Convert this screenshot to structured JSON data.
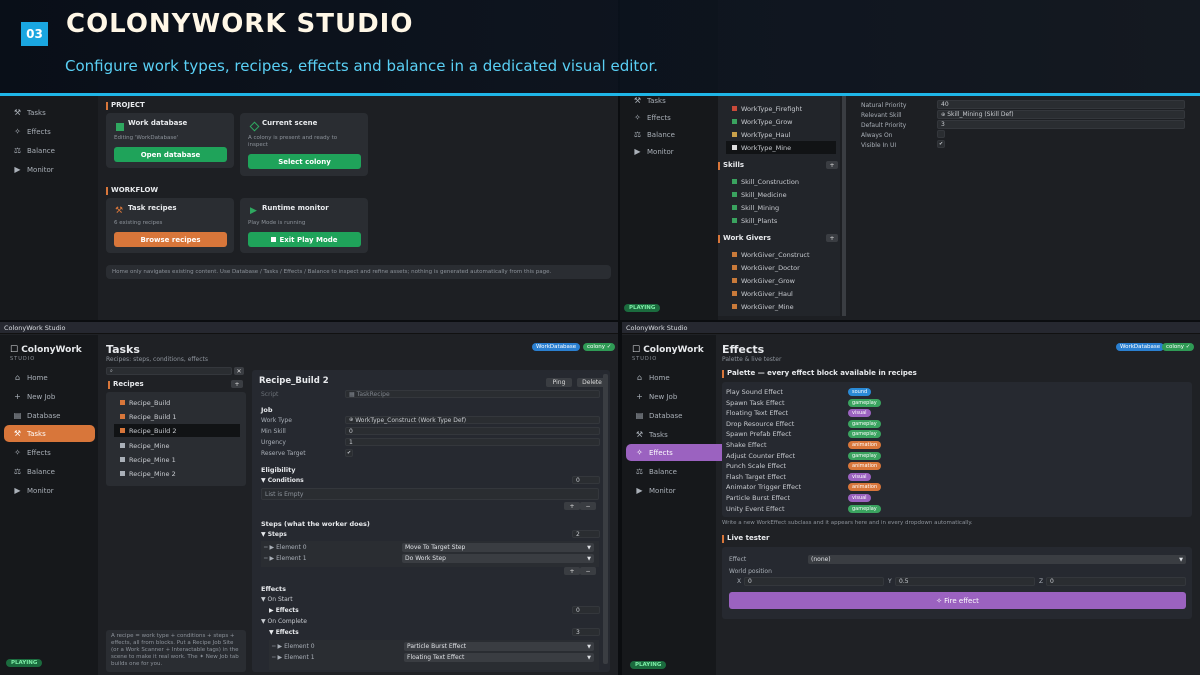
{
  "banner": {
    "badge": "03",
    "title": "COLONYWORK STUDIO",
    "subtitle": "Configure work types, recipes, effects and balance in a dedicated visual editor."
  },
  "nav_common": {
    "tasks": "Tasks",
    "effects": "Effects",
    "balance": "Balance",
    "monitor": "Monitor",
    "home": "Home",
    "new_job": "New Job",
    "database": "Database"
  },
  "status": {
    "playing": "PLAYING"
  },
  "home": {
    "project_label": "PROJECT",
    "workdb_title": "Work database",
    "workdb_desc": "Editing 'WorkDatabase'",
    "workdb_btn": "Open database",
    "scene_title": "Current scene",
    "scene_desc": "A colony is present and ready to inspect",
    "scene_btn": "Select colony",
    "workflow_label": "WORKFLOW",
    "recipes_title": "Task recipes",
    "recipes_desc": "6 existing recipes",
    "recipes_btn": "Browse recipes",
    "monitor_title": "Runtime monitor",
    "monitor_desc": "Play Mode is running",
    "monitor_btn": "Exit Play Mode",
    "footer": "Home only navigates existing content. Use Database / Tasks / Effects / Balance to inspect and refine assets; nothing is generated automatically from this page."
  },
  "database": {
    "worktypes": [
      "WorkType_Firefight",
      "WorkType_Grow",
      "WorkType_Haul",
      "WorkType_Mine"
    ],
    "skills_label": "Skills",
    "skills": [
      "Skill_Construction",
      "Skill_Medicine",
      "Skill_Mining",
      "Skill_Plants"
    ],
    "givers_label": "Work Givers",
    "givers": [
      "WorkGiver_Construct",
      "WorkGiver_Doctor",
      "WorkGiver_Grow",
      "WorkGiver_Haul",
      "WorkGiver_Mine"
    ],
    "props": [
      {
        "k": "Natural Priority",
        "v": "40"
      },
      {
        "k": "Relevant Skill",
        "v": "Skill_Mining (Skill Def)"
      },
      {
        "k": "Default Priority",
        "v": "3"
      },
      {
        "k": "Always On",
        "v": ""
      },
      {
        "k": "Visible In UI",
        "v": "✔"
      }
    ]
  },
  "tasks": {
    "tab": "ColonyWork Studio",
    "brand": "ColonyWork",
    "brand_sub": "STUDIO",
    "title": "Tasks",
    "subtitle": "Recipes: steps, conditions, effects",
    "pill_db": "WorkDatabase",
    "pill_colony": "colony ✓",
    "recipes_label": "Recipes",
    "recipes": [
      "Recipe_Build",
      "Recipe_Build 1",
      "Recipe_Build 2",
      "Recipe_Mine",
      "Recipe_Mine 1",
      "Recipe_Mine 2"
    ],
    "help": "A recipe = work type + conditions + steps + effects, all from blocks. Put a Recipe Job Site (or a Work Scanner + Interactable tags) in the scene to make it real work. The ✦ New Job tab builds one for you.",
    "detail_title": "Recipe_Build 2",
    "ping": "Ping",
    "delete": "Delete",
    "script_label": "Script",
    "script_val": "TaskRecipe",
    "job_label": "Job",
    "work_type_label": "Work Type",
    "work_type_val": "WorkType_Construct (Work Type Def)",
    "min_skill_label": "Min Skill",
    "min_skill_val": "0",
    "urgency_label": "Urgency",
    "urgency_val": "1",
    "reserve_label": "Reserve Target",
    "reserve_val": "✔",
    "elig_label": "Eligibility",
    "conditions_label": "Conditions",
    "conditions_count": "0",
    "empty": "List is Empty",
    "steps_section": "Steps (what the worker does)",
    "steps_label": "Steps",
    "steps_count": "2",
    "el0": "Element 0",
    "el0_val": "Move To Target Step",
    "el1": "Element 1",
    "el1_val": "Do Work Step",
    "effects_section": "Effects",
    "on_start": "On Start",
    "effects_label": "Effects",
    "start_count": "0",
    "on_complete": "On Complete",
    "complete_count": "3",
    "ce0": "Element 0",
    "ce0_val": "Particle Burst Effect",
    "ce1": "Element 1",
    "ce1_val": "Floating Text Effect"
  },
  "effects": {
    "tab": "ColonyWork Studio",
    "brand": "ColonyWork",
    "brand_sub": "STUDIO",
    "title": "Effects",
    "subtitle": "Palette & live tester",
    "pill_db": "WorkDatabase",
    "pill_colony": "colony ✓",
    "palette_label": "Palette — every effect block available in recipes",
    "items": [
      {
        "n": "Play Sound Effect",
        "t": "sound",
        "c": "#2a8ad6"
      },
      {
        "n": "Spawn Task Effect",
        "t": "gameplay",
        "c": "#3aa35f"
      },
      {
        "n": "Floating Text Effect",
        "t": "visual",
        "c": "#9b62c0"
      },
      {
        "n": "Drop Resource Effect",
        "t": "gameplay",
        "c": "#3aa35f"
      },
      {
        "n": "Spawn Prefab Effect",
        "t": "gameplay",
        "c": "#3aa35f"
      },
      {
        "n": "Shake Effect",
        "t": "animation",
        "c": "#d8763a"
      },
      {
        "n": "Adjust Counter Effect",
        "t": "gameplay",
        "c": "#3aa35f"
      },
      {
        "n": "Punch Scale Effect",
        "t": "animation",
        "c": "#d8763a"
      },
      {
        "n": "Flash Target Effect",
        "t": "visual",
        "c": "#9b62c0"
      },
      {
        "n": "Animator Trigger Effect",
        "t": "animation",
        "c": "#d8763a"
      },
      {
        "n": "Particle Burst Effect",
        "t": "visual",
        "c": "#9b62c0"
      },
      {
        "n": "Unity Event Effect",
        "t": "gameplay",
        "c": "#3aa35f"
      }
    ],
    "hint": "Write a new WorkEffect subclass and it appears here and in every dropdown automatically.",
    "tester_label": "Live tester",
    "effect_label": "Effect",
    "effect_val": "(none)",
    "world_pos": "World position",
    "x": "X",
    "x_val": "0",
    "y": "Y",
    "y_val": "0.5",
    "z": "Z",
    "z_val": "0",
    "fire": "✧ Fire effect"
  }
}
